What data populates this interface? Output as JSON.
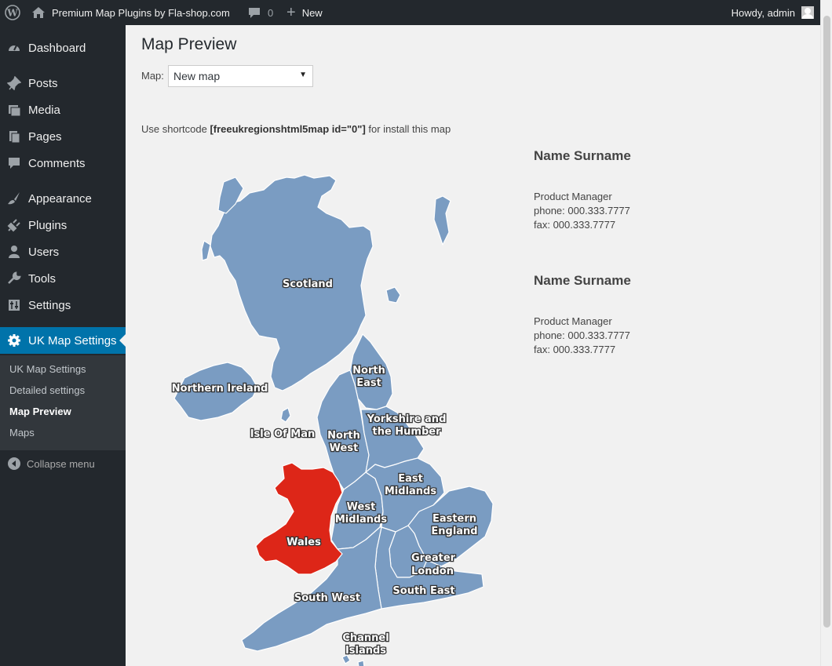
{
  "adminbar": {
    "site_name": "Premium Map Plugins by Fla-shop.com",
    "comments_count": "0",
    "new_label": "New",
    "howdy": "Howdy, admin"
  },
  "sidebar": {
    "items": [
      {
        "label": "Dashboard",
        "icon": "dashboard-icon"
      },
      {
        "label": "Posts",
        "icon": "pin-icon"
      },
      {
        "label": "Media",
        "icon": "media-icon"
      },
      {
        "label": "Pages",
        "icon": "pages-icon"
      },
      {
        "label": "Comments",
        "icon": "comment-icon"
      },
      {
        "label": "Appearance",
        "icon": "brush-icon"
      },
      {
        "label": "Plugins",
        "icon": "plug-icon"
      },
      {
        "label": "Users",
        "icon": "user-icon"
      },
      {
        "label": "Tools",
        "icon": "wrench-icon"
      },
      {
        "label": "Settings",
        "icon": "settings-icon"
      },
      {
        "label": "UK Map Settings",
        "icon": "gear-icon"
      }
    ],
    "submenu": [
      "UK Map Settings",
      "Detailed settings",
      "Map Preview",
      "Maps"
    ],
    "collapse": "Collapse menu"
  },
  "main": {
    "title": "Map Preview",
    "map_label": "Map:",
    "map_selected": "New map",
    "shortcode_prefix": "Use shortcode ",
    "shortcode": "[freeukregionshtml5map id=\"0\"]",
    "shortcode_suffix": " for install this map"
  },
  "contacts": [
    {
      "name": "Name Surname",
      "role": "Product Manager",
      "phone": "phone: 000.333.7777",
      "fax": "fax: 000.333.7777"
    },
    {
      "name": "Name Surname",
      "role": "Product Manager",
      "phone": "phone: 000.333.7777",
      "fax": "fax: 000.333.7777"
    }
  ],
  "map": {
    "region_color": "#7a9cc2",
    "highlight_color": "#dd2618",
    "border_color": "#ffffff",
    "regions": {
      "scotland": "Scotland",
      "northern_ireland": "Northern Ireland",
      "isle_of_man": "Isle Of Man",
      "north_east_1": "North",
      "north_east_2": "East",
      "north_west_1": "North",
      "north_west_2": "West",
      "yorkshire_1": "Yorkshire and",
      "yorkshire_2": "the Humber",
      "east_midlands_1": "East",
      "east_midlands_2": "Midlands",
      "west_midlands_1": "West",
      "west_midlands_2": "Midlands",
      "eastern_1": "Eastern",
      "eastern_2": "England",
      "wales": "Wales",
      "london_1": "Greater",
      "london_2": "London",
      "south_east": "South East",
      "south_west": "South West",
      "channel_1": "Channel",
      "channel_2": "Islands"
    }
  }
}
